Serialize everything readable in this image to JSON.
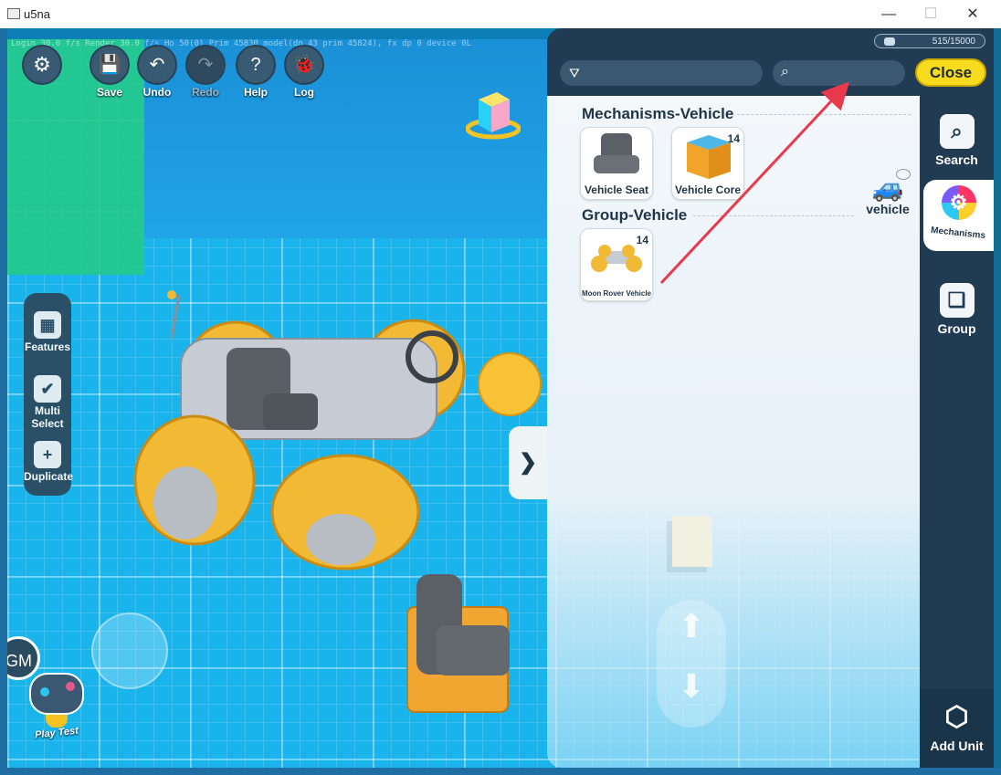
{
  "window": {
    "title": "u5na",
    "minimize": "—",
    "maximize": "☐",
    "close": "✕"
  },
  "debug_overlay": "Login 30.0 f/s  Render 30.0 f/s  Ho 50(0)  Prim 45830 model(dp 43 prim 45824), fx dp 0  device 0L",
  "toolbar": {
    "settings_icon": "gear-icon",
    "items": [
      {
        "label": "Save",
        "icon": "💾"
      },
      {
        "label": "Undo",
        "icon": "↶"
      },
      {
        "label": "Redo",
        "icon": "↷",
        "disabled": true
      },
      {
        "label": "Help",
        "icon": "?"
      },
      {
        "label": "Log",
        "icon": "🐞"
      }
    ]
  },
  "left_tools": [
    {
      "label": "Features",
      "icon": "▦"
    },
    {
      "label": "Multi Select",
      "icon": "✔"
    },
    {
      "label": "Duplicate",
      "icon": "+"
    }
  ],
  "gm_label": "GM",
  "playtest_label": "Play Test",
  "panel": {
    "unit_counter": "515/15000",
    "search_value": "",
    "close_label": "Close",
    "expander_glyph": "❯",
    "vehicle_tag": "vehicle",
    "sections": [
      {
        "title": "Mechanisms-Vehicle",
        "items": [
          {
            "name": "Vehicle Seat",
            "count": ""
          },
          {
            "name": "Vehicle Core",
            "count": "14"
          }
        ]
      },
      {
        "title": "Group-Vehicle",
        "items": [
          {
            "name": "Moon Rover Vehicle",
            "count": "14"
          }
        ]
      }
    ]
  },
  "rail": {
    "items": [
      {
        "label": "Search",
        "icon": "⌕"
      },
      {
        "label": "Mechanisms",
        "icon": "⚙",
        "active": true
      },
      {
        "label": "Group",
        "icon": "❏"
      }
    ],
    "add_unit": "Add Unit"
  },
  "colors": {
    "accent_yellow": "#f7dc1e",
    "panel_dark": "#203b52",
    "floor": "#19b4ec",
    "annotation_arrow": "#e8394d"
  }
}
